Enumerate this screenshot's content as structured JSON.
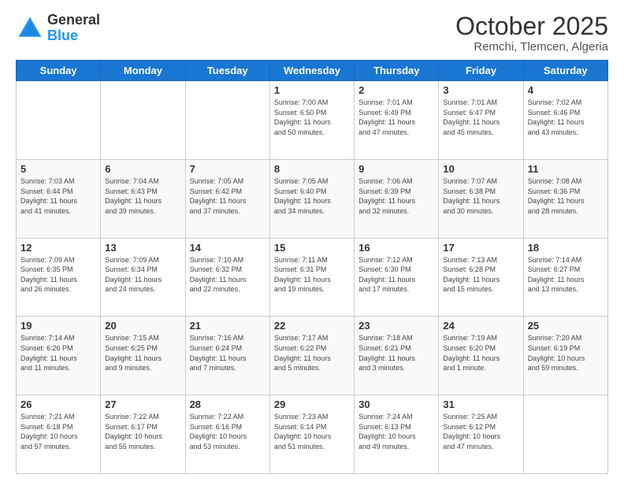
{
  "header": {
    "logo_general": "General",
    "logo_blue": "Blue",
    "month_title": "October 2025",
    "location": "Remchi, Tlemcen, Algeria"
  },
  "days_of_week": [
    "Sunday",
    "Monday",
    "Tuesday",
    "Wednesday",
    "Thursday",
    "Friday",
    "Saturday"
  ],
  "weeks": [
    [
      {
        "day": "",
        "info": ""
      },
      {
        "day": "",
        "info": ""
      },
      {
        "day": "",
        "info": ""
      },
      {
        "day": "1",
        "info": "Sunrise: 7:00 AM\nSunset: 6:50 PM\nDaylight: 11 hours\nand 50 minutes."
      },
      {
        "day": "2",
        "info": "Sunrise: 7:01 AM\nSunset: 6:49 PM\nDaylight: 11 hours\nand 47 minutes."
      },
      {
        "day": "3",
        "info": "Sunrise: 7:01 AM\nSunset: 6:47 PM\nDaylight: 11 hours\nand 45 minutes."
      },
      {
        "day": "4",
        "info": "Sunrise: 7:02 AM\nSunset: 6:46 PM\nDaylight: 11 hours\nand 43 minutes."
      }
    ],
    [
      {
        "day": "5",
        "info": "Sunrise: 7:03 AM\nSunset: 6:44 PM\nDaylight: 11 hours\nand 41 minutes."
      },
      {
        "day": "6",
        "info": "Sunrise: 7:04 AM\nSunset: 6:43 PM\nDaylight: 11 hours\nand 39 minutes."
      },
      {
        "day": "7",
        "info": "Sunrise: 7:05 AM\nSunset: 6:42 PM\nDaylight: 11 hours\nand 37 minutes."
      },
      {
        "day": "8",
        "info": "Sunrise: 7:05 AM\nSunset: 6:40 PM\nDaylight: 11 hours\nand 34 minutes."
      },
      {
        "day": "9",
        "info": "Sunrise: 7:06 AM\nSunset: 6:39 PM\nDaylight: 11 hours\nand 32 minutes."
      },
      {
        "day": "10",
        "info": "Sunrise: 7:07 AM\nSunset: 6:38 PM\nDaylight: 11 hours\nand 30 minutes."
      },
      {
        "day": "11",
        "info": "Sunrise: 7:08 AM\nSunset: 6:36 PM\nDaylight: 11 hours\nand 28 minutes."
      }
    ],
    [
      {
        "day": "12",
        "info": "Sunrise: 7:09 AM\nSunset: 6:35 PM\nDaylight: 11 hours\nand 26 minutes."
      },
      {
        "day": "13",
        "info": "Sunrise: 7:09 AM\nSunset: 6:34 PM\nDaylight: 11 hours\nand 24 minutes."
      },
      {
        "day": "14",
        "info": "Sunrise: 7:10 AM\nSunset: 6:32 PM\nDaylight: 11 hours\nand 22 minutes."
      },
      {
        "day": "15",
        "info": "Sunrise: 7:11 AM\nSunset: 6:31 PM\nDaylight: 11 hours\nand 19 minutes."
      },
      {
        "day": "16",
        "info": "Sunrise: 7:12 AM\nSunset: 6:30 PM\nDaylight: 11 hours\nand 17 minutes."
      },
      {
        "day": "17",
        "info": "Sunrise: 7:13 AM\nSunset: 6:28 PM\nDaylight: 11 hours\nand 15 minutes."
      },
      {
        "day": "18",
        "info": "Sunrise: 7:14 AM\nSunset: 6:27 PM\nDaylight: 11 hours\nand 13 minutes."
      }
    ],
    [
      {
        "day": "19",
        "info": "Sunrise: 7:14 AM\nSunset: 6:26 PM\nDaylight: 11 hours\nand 11 minutes."
      },
      {
        "day": "20",
        "info": "Sunrise: 7:15 AM\nSunset: 6:25 PM\nDaylight: 11 hours\nand 9 minutes."
      },
      {
        "day": "21",
        "info": "Sunrise: 7:16 AM\nSunset: 6:24 PM\nDaylight: 11 hours\nand 7 minutes."
      },
      {
        "day": "22",
        "info": "Sunrise: 7:17 AM\nSunset: 6:22 PM\nDaylight: 11 hours\nand 5 minutes."
      },
      {
        "day": "23",
        "info": "Sunrise: 7:18 AM\nSunset: 6:21 PM\nDaylight: 11 hours\nand 3 minutes."
      },
      {
        "day": "24",
        "info": "Sunrise: 7:19 AM\nSunset: 6:20 PM\nDaylight: 11 hours\nand 1 minute."
      },
      {
        "day": "25",
        "info": "Sunrise: 7:20 AM\nSunset: 6:19 PM\nDaylight: 10 hours\nand 59 minutes."
      }
    ],
    [
      {
        "day": "26",
        "info": "Sunrise: 7:21 AM\nSunset: 6:18 PM\nDaylight: 10 hours\nand 57 minutes."
      },
      {
        "day": "27",
        "info": "Sunrise: 7:22 AM\nSunset: 6:17 PM\nDaylight: 10 hours\nand 55 minutes."
      },
      {
        "day": "28",
        "info": "Sunrise: 7:22 AM\nSunset: 6:16 PM\nDaylight: 10 hours\nand 53 minutes."
      },
      {
        "day": "29",
        "info": "Sunrise: 7:23 AM\nSunset: 6:14 PM\nDaylight: 10 hours\nand 51 minutes."
      },
      {
        "day": "30",
        "info": "Sunrise: 7:24 AM\nSunset: 6:13 PM\nDaylight: 10 hours\nand 49 minutes."
      },
      {
        "day": "31",
        "info": "Sunrise: 7:25 AM\nSunset: 6:12 PM\nDaylight: 10 hours\nand 47 minutes."
      },
      {
        "day": "",
        "info": ""
      }
    ]
  ]
}
